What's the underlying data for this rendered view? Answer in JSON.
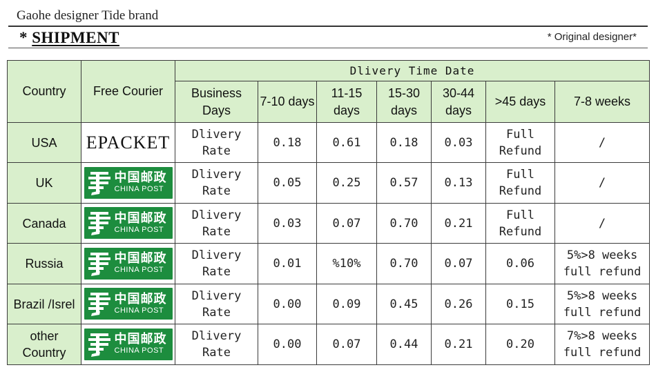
{
  "header": {
    "brand": "Gaohe designer Tide brand",
    "title_mark": "*",
    "title": "SHIPMENT",
    "original": "* Original designer*"
  },
  "table": {
    "col_country": "Country",
    "col_courier": "Free Courier",
    "group_header": "Dlivery Time Date",
    "sub_headers": [
      "Business Days",
      "7-10 days",
      "11-15 days",
      "15-30 days",
      "30-44 days",
      ">45 days",
      "7-8 weeks"
    ],
    "rows": [
      {
        "country": "USA",
        "courier": "EPACKET",
        "courier_type": "text",
        "rate": "Dlivery Rate",
        "v1": "0.18",
        "v2": "0.61",
        "v3": "0.18",
        "v4": "0.03",
        "v5": "Full Refund",
        "v6": "/"
      },
      {
        "country": "UK",
        "courier": "中国邮政",
        "courier_en": "CHINA POST",
        "courier_type": "logo",
        "rate": "Dlivery Rate",
        "v1": "0.05",
        "v2": "0.25",
        "v3": "0.57",
        "v4": "0.13",
        "v5": "Full Refund",
        "v6": "/"
      },
      {
        "country": "Canada",
        "courier": "中国邮政",
        "courier_en": "CHINA POST",
        "courier_type": "logo",
        "rate": "Dlivery Rate",
        "v1": "0.03",
        "v2": "0.07",
        "v3": "0.70",
        "v4": "0.21",
        "v5": "Full Refund",
        "v6": "/"
      },
      {
        "country": "Russia",
        "courier": "中国邮政",
        "courier_en": "CHINA POST",
        "courier_type": "logo",
        "rate": "Dlivery Rate",
        "v1": "0.01",
        "v2": "%10%",
        "v3": "0.70",
        "v4": "0.07",
        "v5": "0.06",
        "v6": "5%>8 weeks full refund"
      },
      {
        "country": "Brazil /Isrel",
        "courier": "中国邮政",
        "courier_en": "CHINA POST",
        "courier_type": "logo",
        "rate": "Dlivery Rate",
        "v1": "0.00",
        "v2": "0.09",
        "v3": "0.45",
        "v4": "0.26",
        "v5": "0.15",
        "v6": "5%>8 weeks full refund"
      },
      {
        "country": "other Country",
        "courier": "中国邮政",
        "courier_en": "CHINA POST",
        "courier_type": "logo",
        "rate": "Dlivery Rate",
        "v1": "0.00",
        "v2": "0.07",
        "v3": "0.44",
        "v4": "0.21",
        "v5": "0.20",
        "v6": "7%>8 weeks full refund"
      }
    ]
  },
  "colors": {
    "header_bg": "#d9efcc",
    "logo_green": "#1d8d3e",
    "border": "#3a3a3a"
  },
  "icons": {
    "china_post": "china-post-logo-icon"
  }
}
